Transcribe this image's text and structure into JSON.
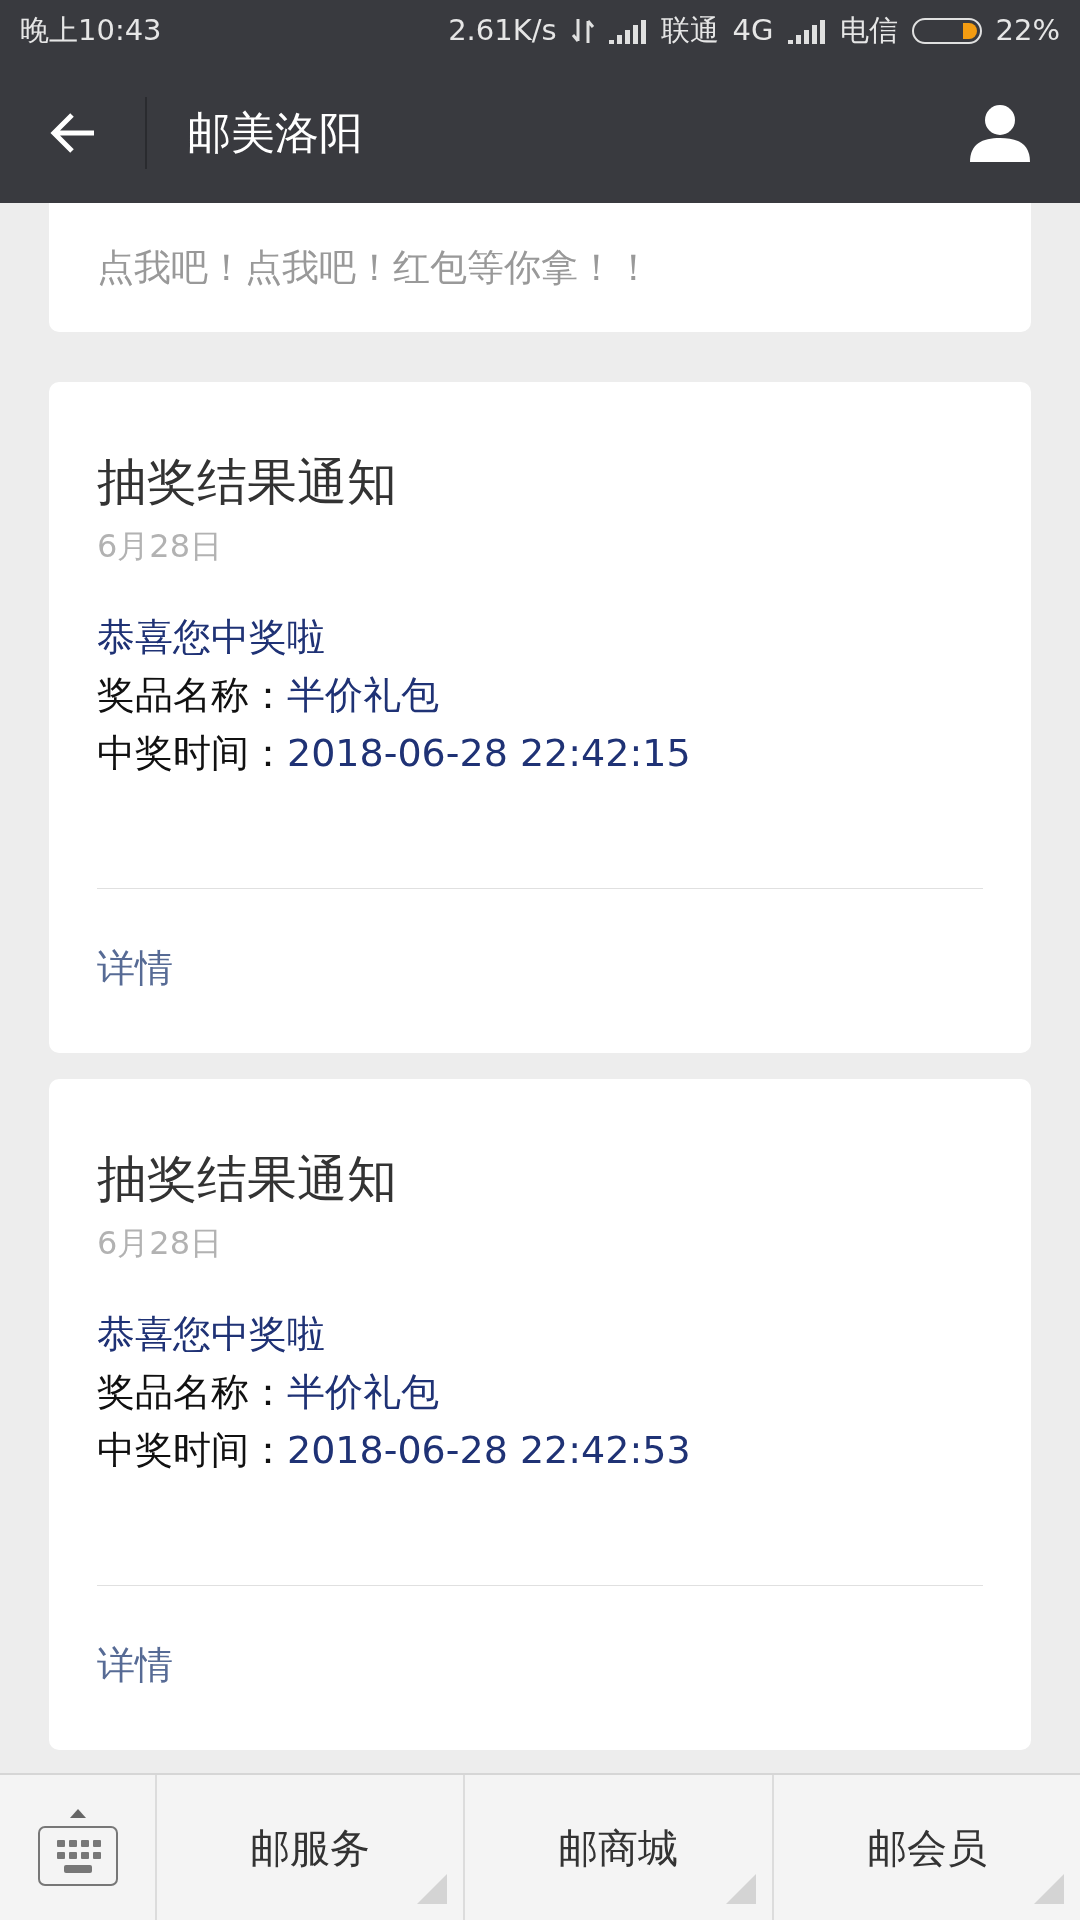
{
  "status_bar": {
    "time": "晚上10:43",
    "speed": "2.61K/s",
    "carrier_1": "联通",
    "network_1": "4G",
    "carrier_2": "电信",
    "battery": {
      "level": 0.22
    },
    "battery_text": "22%"
  },
  "header": {
    "title": "邮美洛阳"
  },
  "partial_card": {
    "text": "点我吧！点我吧！红包等你拿！！"
  },
  "cards": [
    {
      "title": "抽奖结果通知",
      "date": "6月28日",
      "greeting": "恭喜您中奖啦",
      "fields": [
        {
          "label": "奖品名称：",
          "value": "半价礼包"
        },
        {
          "label": "中奖时间：",
          "value": "2018-06-28 22:42:15"
        }
      ],
      "link": "详情"
    },
    {
      "title": "抽奖结果通知",
      "date": "6月28日",
      "greeting": "恭喜您中奖啦",
      "fields": [
        {
          "label": "奖品名称：",
          "value": "半价礼包"
        },
        {
          "label": "中奖时间：",
          "value": "2018-06-28 22:42:53"
        }
      ],
      "link": "详情"
    }
  ],
  "menu": [
    {
      "label": "邮服务"
    },
    {
      "label": "邮商城"
    },
    {
      "label": "邮会员"
    }
  ]
}
